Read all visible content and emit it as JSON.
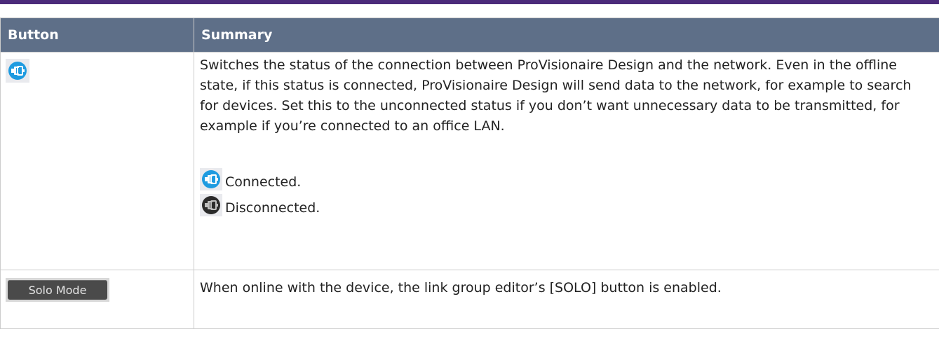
{
  "table": {
    "headers": [
      "Button",
      "Summary"
    ],
    "rows": [
      {
        "button_icon": "network-connect-icon",
        "summary": "Switches the status of the connection between ProVisionaire Design and the network. Even in the offline state, if this status is connected, ProVisionaire Design will send data to the network, for example to search for devices. Set this to the unconnected status if you don’t want unnecessary data to be transmitted, for example if you’re connected to an office LAN.",
        "states": [
          {
            "icon": "connected-icon",
            "label": "Connected."
          },
          {
            "icon": "disconnected-icon",
            "label": "Disconnected."
          }
        ]
      },
      {
        "button_label": "Solo Mode",
        "summary": "When online with the device, the link group editor’s [SOLO] button is enabled."
      }
    ]
  },
  "colors": {
    "accent_rule": "#4b2a7a",
    "header_bg": "#5e6f88",
    "connected_blue": "#1e9be0",
    "disconnected_dark": "#2b2b2b"
  }
}
